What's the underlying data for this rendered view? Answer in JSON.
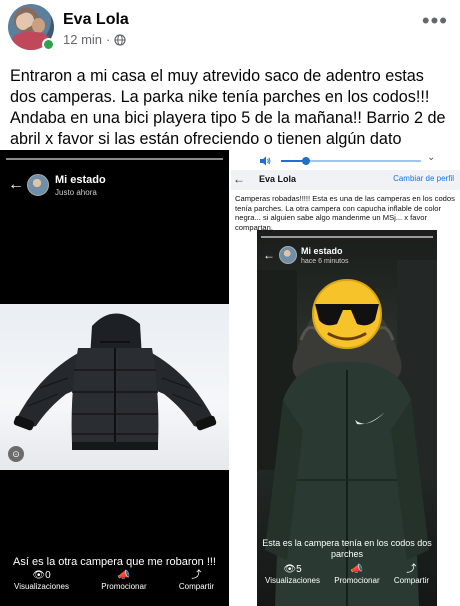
{
  "post": {
    "author": "Eva Lola",
    "time": "12 min",
    "separator": "·",
    "text": "Entraron a mi casa el muy atrevido saco de adentro estas dos camperas. La parka nike tenía parches en los codos!!! Andaba en una bici playera tipo 5 de la mañana!! Barrio 2 de abril x favor si las están ofreciendo o tienen algún dato déjenme un mensaje!!!",
    "more_icon": "more-dots-icon",
    "privacy_icon": "globe-icon"
  },
  "left_story": {
    "title": "Mi estado",
    "subtitle": "Justo ahora",
    "caption": "Así es la otra campera que me robaron !!!",
    "views_count": "0",
    "views_label": "Visualizaciones",
    "promote_label": "Promocionar",
    "share_label": "Compartir"
  },
  "right_shot": {
    "profile_name": "Eva Lola",
    "profile_link": "Cambiar de perfil",
    "text": "Camperas robadas!!!!! Esta es una de las camperas en los codos tenía parches. La otra campera con capucha inflable de color negra... si alguien sabe algo mandenme un MSj... x favor compartan.",
    "audio_progress": 0.18,
    "story": {
      "title": "Mi estado",
      "subtitle": "hace 6 minutos",
      "caption": "Esta es la campera tenía en los codos dos parches",
      "views_count": "5",
      "views_label": "Visualizaciones",
      "promote_label": "Promocionar",
      "share_label": "Compartir"
    }
  },
  "colors": {
    "link": "#1b74e4",
    "online": "#31a24c",
    "muted": "#65676b"
  }
}
